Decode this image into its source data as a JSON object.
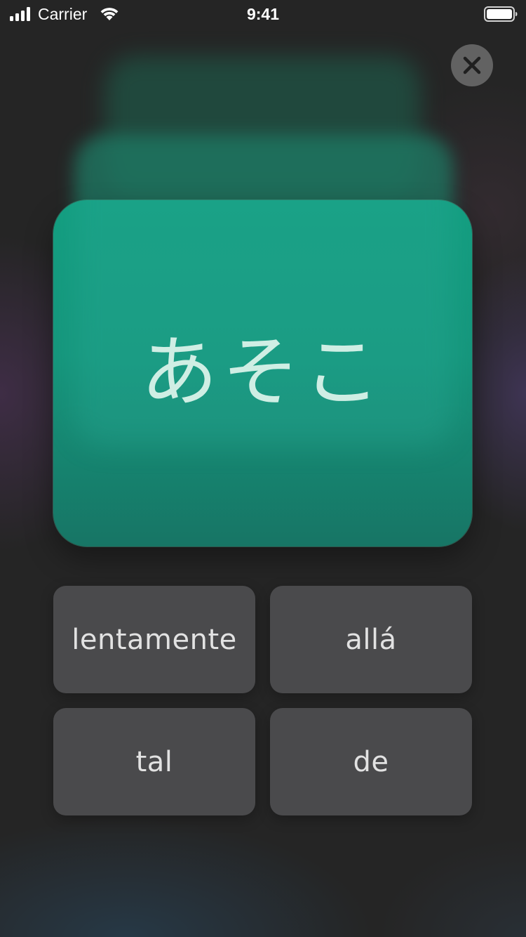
{
  "status_bar": {
    "carrier": "Carrier",
    "time": "9:41",
    "icons": [
      "signal-bars-icon",
      "wifi-icon",
      "battery-icon"
    ]
  },
  "close_button": {
    "icon": "close-icon"
  },
  "flashcard": {
    "word": "あそこ",
    "color": "#139e80"
  },
  "answers": [
    {
      "label": "lentamente"
    },
    {
      "label": "allá"
    },
    {
      "label": "tal"
    },
    {
      "label": "de"
    }
  ]
}
